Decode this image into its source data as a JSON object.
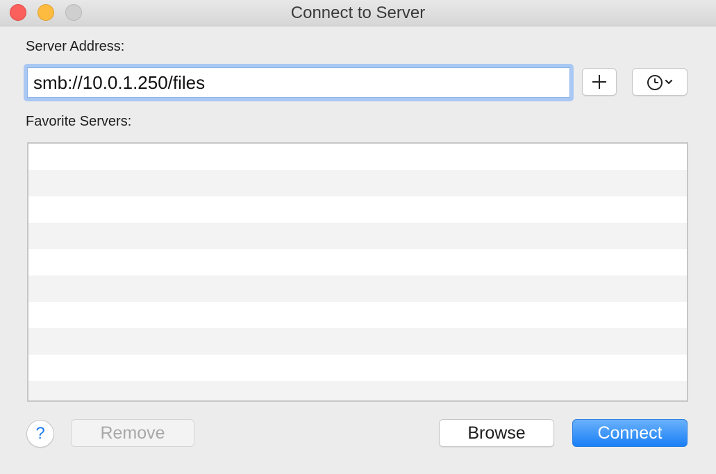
{
  "window": {
    "title": "Connect to Server"
  },
  "server_address": {
    "label": "Server Address:",
    "value": "smb://10.0.1.250/files",
    "add_button_icon": "plus-icon",
    "recent_button_icons": [
      "clock-icon",
      "chevron-down-icon"
    ]
  },
  "favorites": {
    "label": "Favorite Servers:",
    "items": []
  },
  "footer": {
    "help_label": "?",
    "remove_label": "Remove",
    "browse_label": "Browse",
    "connect_label": "Connect"
  },
  "colors": {
    "accent": "#1a7ff6",
    "close": "#fc605c",
    "minimize": "#fdbc40",
    "zoom_disabled": "#cfcfcf"
  }
}
